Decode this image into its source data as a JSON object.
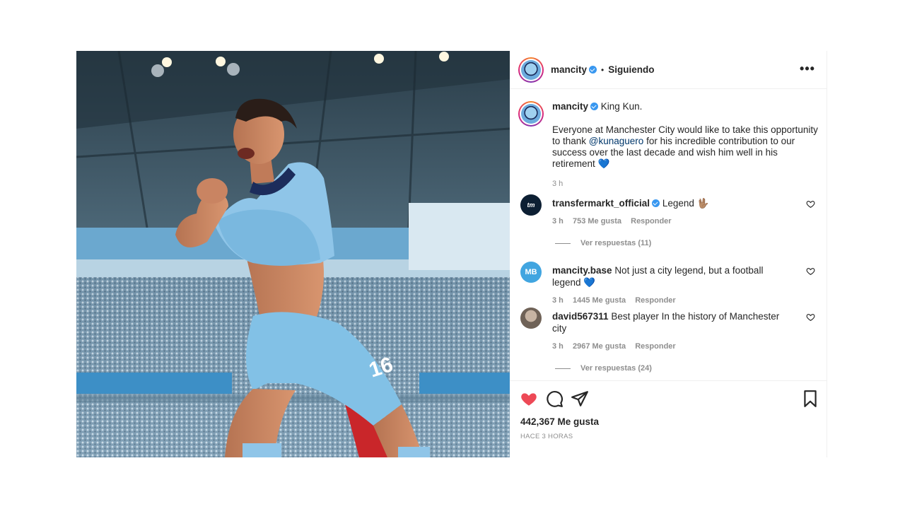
{
  "post": {
    "author": "mancity",
    "separator": "•",
    "follow_state": "Siguiendo",
    "more_label": "•••",
    "caption_title": "King Kun.",
    "caption_part1": "Everyone at Manchester City would like to take this opportunity to thank ",
    "caption_mention": "@kunaguero",
    "caption_part2": " for his incredible contribution to our success over the last decade and wish him well in his retirement 💙",
    "caption_time": "3 h"
  },
  "photo": {
    "jersey_number": "16"
  },
  "comments": [
    {
      "user": "transfermarkt_official",
      "avatar_text": "tm",
      "avatar_color": "#0d1f33",
      "verified": true,
      "text": "Legend 🖖🏽",
      "time": "3 h",
      "likes": "753 Me gusta",
      "reply": "Responder",
      "view_replies": "Ver respuestas (11)"
    },
    {
      "user": "mancity.base",
      "avatar_text": "MB",
      "avatar_color": "#41a5e0",
      "verified": false,
      "text": "Not just a city legend, but a football legend 💙",
      "time": "3 h",
      "likes": "1445 Me gusta",
      "reply": "Responder"
    },
    {
      "user": "david567311",
      "avatar_text": "",
      "avatar_color": "#9a8a7c",
      "verified": false,
      "text": "Best player In the history of Manchester city",
      "time": "3 h",
      "likes": "2967 Me gusta",
      "reply": "Responder",
      "view_replies": "Ver respuestas (24)"
    }
  ],
  "footer": {
    "likes_count": "442,367 Me gusta",
    "time_ago": "HACE 3 HORAS"
  },
  "colors": {
    "like_red": "#ed4956",
    "verified_blue": "#3897f0",
    "city_blue": "#6cabdd"
  },
  "icons": [
    "heart-filled-icon",
    "comment-icon",
    "share-icon",
    "bookmark-icon",
    "heart-outline-icon",
    "verified-icon",
    "more-icon"
  ]
}
